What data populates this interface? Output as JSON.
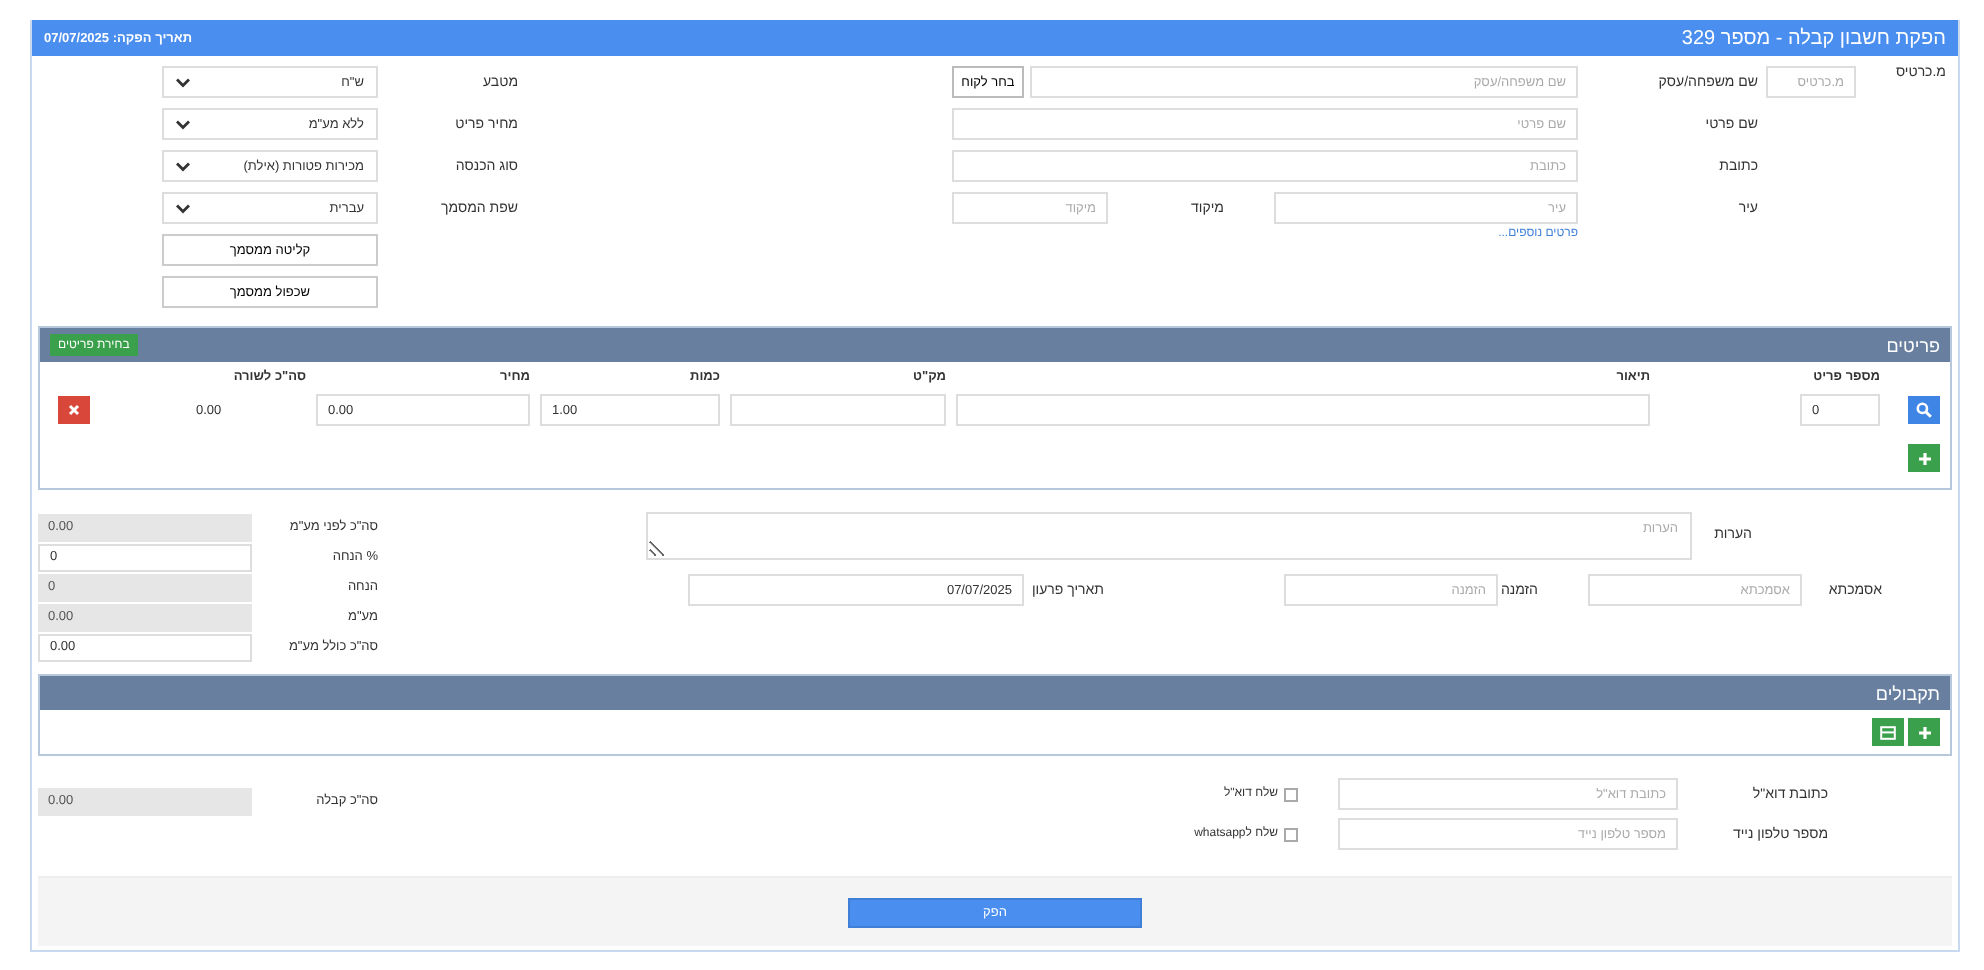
{
  "header": {
    "title": "הפקת חשבון קבלה - מספר 329",
    "issue_date": "תאריך הפקה: 07/07/2025"
  },
  "customer": {
    "card_no": {
      "label": "מ.כרטיס",
      "placeholder": "מ.כרטיס"
    },
    "last_name": {
      "label": "שם משפחה/עסק",
      "placeholder": "שם משפחה/עסק"
    },
    "choose_button": "בחר לקוח",
    "first_name": {
      "label": "שם פרטי",
      "placeholder": "שם פרטי"
    },
    "address": {
      "label": "כתובת",
      "placeholder": "כתובת"
    },
    "city": {
      "label": "עיר",
      "placeholder": "עיר"
    },
    "zip": {
      "label": "מיקוד",
      "placeholder": "מיקוד"
    },
    "more_link": "פרטים נוספים..."
  },
  "settings": [
    {
      "label": "מטבע",
      "value": "ש\"ח"
    },
    {
      "label": "מחיר פריט",
      "value": "ללא מע\"מ"
    },
    {
      "label": "סוג הכנסה",
      "value": "מכירות פטורות (אילת)"
    },
    {
      "label": "שפת המסמך",
      "value": "עברית"
    }
  ],
  "settings_buttons": [
    "קליטה ממסמך",
    "שכפול ממסמך"
  ],
  "items": {
    "title": "פריטים",
    "select_button": "בחירת פריטים",
    "columns": [
      "מספר פריט",
      "תיאור",
      "מק\"ט",
      "כמות",
      "מחיר",
      "סה\"כ לשורה"
    ],
    "rows": [
      {
        "item_no": "0",
        "qty": "1.00",
        "price": "0.00",
        "total": "0.00"
      }
    ]
  },
  "notes": {
    "label": "הערות",
    "placeholder": "הערות"
  },
  "reference": {
    "label": "אסמכתא",
    "placeholder": "אסמכתא"
  },
  "order": {
    "label": "הזמנה",
    "placeholder": "הזמנה"
  },
  "due_date": {
    "label": "תאריך פרעון",
    "value": "07/07/2025"
  },
  "totals": [
    {
      "label": "סה\"כ לפני מע\"מ",
      "value": "0.00",
      "readonly": true
    },
    {
      "label": "% הנחה",
      "value": "0",
      "readonly": false
    },
    {
      "label": "הנחה",
      "value": "0",
      "readonly": true
    },
    {
      "label": "מע\"מ",
      "value": "0.00",
      "readonly": true
    },
    {
      "label": "סה\"כ כולל מע\"מ",
      "value": "0.00",
      "readonly": false
    }
  ],
  "receipts": {
    "title": "תקבולים"
  },
  "contacts": [
    {
      "label": "כתובת דוא\"ל",
      "placeholder": "כתובת דוא\"ל",
      "send_label": "שלח דוא\"ל",
      "checked": false
    },
    {
      "label": "מספר טלפון נייד",
      "placeholder": "מספר טלפון נייד",
      "send_label": "שלח לwhatsapp",
      "checked": false
    }
  ],
  "receipt_total": {
    "label": "סה\"כ קבלה",
    "value": "0.00"
  },
  "submit_button": "הפק"
}
